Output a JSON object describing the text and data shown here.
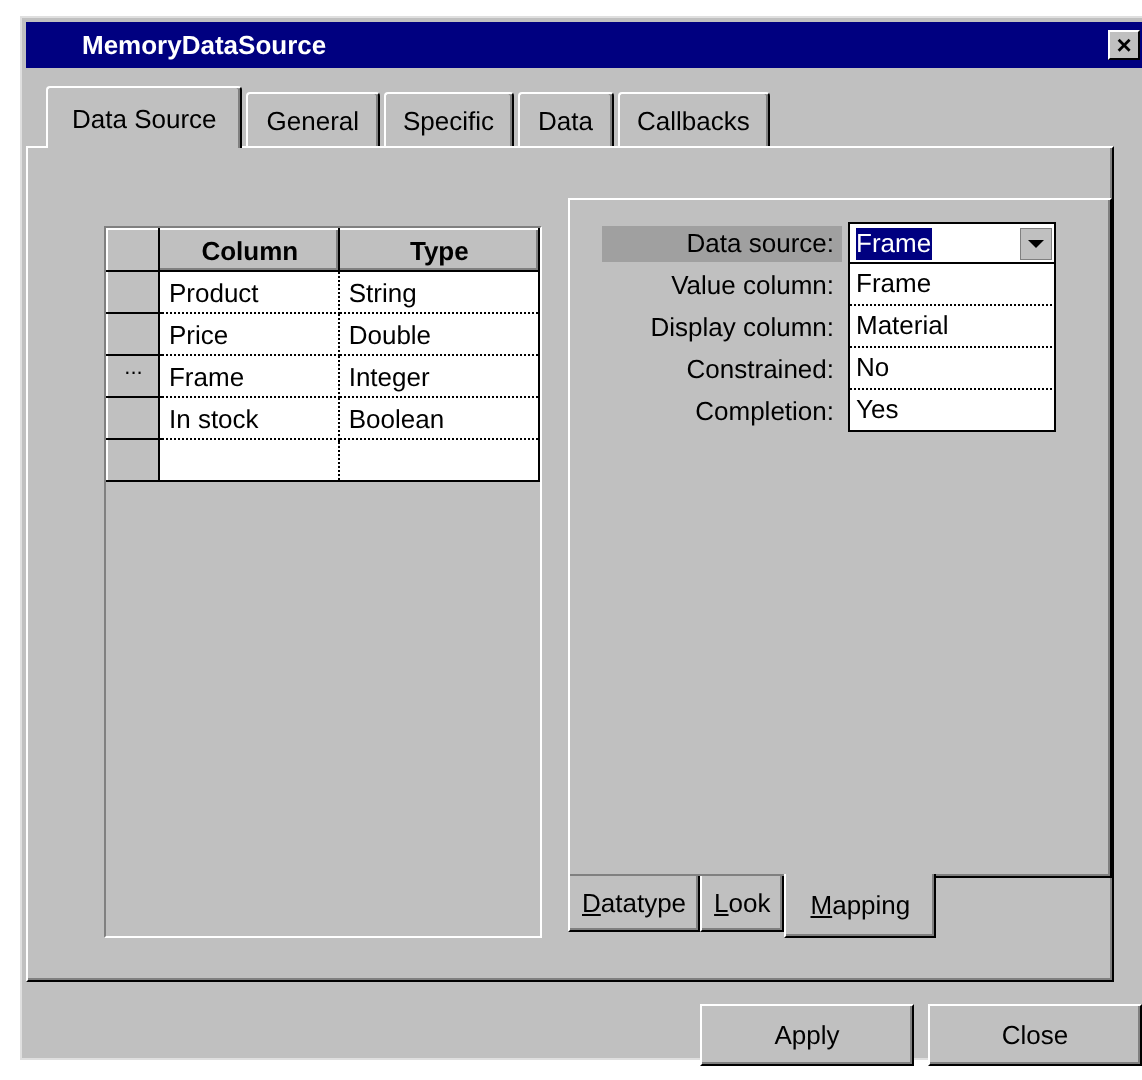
{
  "window": {
    "title": "MemoryDataSource",
    "close": "×"
  },
  "tabs": [
    {
      "label": "Data Source",
      "selected": true
    },
    {
      "label": "General",
      "selected": false
    },
    {
      "label": "Specific",
      "selected": false
    },
    {
      "label": "Data",
      "selected": false
    },
    {
      "label": "Callbacks",
      "selected": false
    }
  ],
  "grid": {
    "columns": [
      "Column",
      "Type"
    ],
    "rows": [
      {
        "marker": "",
        "cells": [
          "Product",
          "String"
        ]
      },
      {
        "marker": "",
        "cells": [
          "Price",
          "Double"
        ]
      },
      {
        "marker": "...",
        "cells": [
          "Frame",
          "Integer"
        ]
      },
      {
        "marker": "",
        "cells": [
          "In stock",
          "Boolean"
        ]
      }
    ],
    "new_row": true
  },
  "properties": [
    {
      "label": "Data source:",
      "value": "Frame",
      "kind": "dropdown",
      "selected": true
    },
    {
      "label": "Value column:",
      "value": "Frame",
      "kind": "text",
      "selected": false
    },
    {
      "label": "Display column:",
      "value": "Material",
      "kind": "text",
      "selected": false
    },
    {
      "label": "Constrained:",
      "value": "No",
      "kind": "text",
      "selected": false
    },
    {
      "label": "Completion:",
      "value": "Yes",
      "kind": "text",
      "selected": false
    }
  ],
  "sub_tabs": [
    {
      "label": "Datatype",
      "selected": false
    },
    {
      "label": "Look",
      "selected": false
    },
    {
      "label": "Mapping",
      "selected": true
    }
  ],
  "buttons": [
    "Apply",
    "Close"
  ]
}
